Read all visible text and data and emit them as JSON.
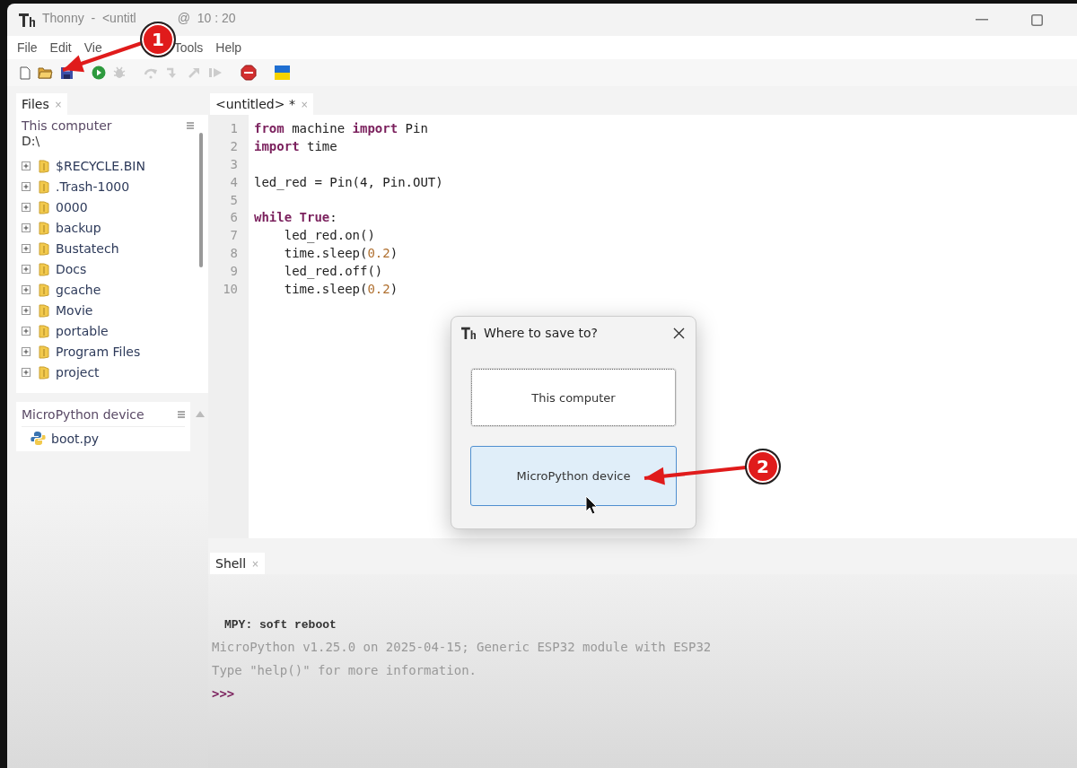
{
  "window": {
    "title": "Thonny  -  <untitl",
    "title_tail": "@  10 : 20"
  },
  "menu": [
    "File",
    "Edit",
    "Vie",
    "Tools",
    "Help"
  ],
  "files_panel": {
    "tab": {
      "label": "Files",
      "close": "×"
    },
    "location": "This computer",
    "path": "D:\\",
    "items": [
      {
        "name": "$RECYCLE.BIN",
        "expanded": false
      },
      {
        "name": ".Trash-1000",
        "expanded": false
      },
      {
        "name": "0000",
        "expanded": false
      },
      {
        "name": "backup",
        "expanded": false
      },
      {
        "name": "Bustatech",
        "expanded": false
      },
      {
        "name": "Docs",
        "expanded": false
      },
      {
        "name": "gcache",
        "expanded": false
      },
      {
        "name": "Movie",
        "expanded": false
      },
      {
        "name": "portable",
        "expanded": false
      },
      {
        "name": "Program Files",
        "expanded": false
      },
      {
        "name": "project",
        "expanded": false
      }
    ],
    "device": {
      "title": "MicroPython device",
      "files": [
        "boot.py"
      ]
    }
  },
  "editor": {
    "tab": {
      "label": "<untitled> *",
      "close": "×"
    },
    "lines": [
      {
        "number": "1",
        "tokens": [
          {
            "kind": "keyword",
            "text": "from"
          },
          {
            "kind": "plain",
            "text": " machine "
          },
          {
            "kind": "keyword",
            "text": "import"
          },
          {
            "kind": "plain",
            "text": " Pin"
          }
        ]
      },
      {
        "number": "2",
        "tokens": [
          {
            "kind": "keyword",
            "text": "import"
          },
          {
            "kind": "plain",
            "text": " time"
          }
        ]
      },
      {
        "number": "3"
      },
      {
        "number": "4",
        "tokens": [
          {
            "kind": "plain",
            "text": "led_red = Pin(4, Pin.OUT)"
          }
        ]
      },
      {
        "number": "5"
      },
      {
        "number": "6",
        "tokens": [
          {
            "kind": "keyword",
            "text": "while"
          },
          {
            "kind": "keyword",
            "text": " True"
          },
          {
            "kind": "plain",
            "text": ":"
          }
        ]
      },
      {
        "number": "7",
        "tokens": [
          {
            "kind": "plain",
            "text": "    led_red.on()"
          }
        ]
      },
      {
        "number": "8",
        "tokens": [
          {
            "kind": "plain",
            "text": "    time.sleep("
          },
          {
            "kind": "number",
            "text": "0.2"
          },
          {
            "kind": "plain",
            "text": ")"
          }
        ]
      },
      {
        "number": "9",
        "tokens": [
          {
            "kind": "plain",
            "text": "    led_red.off()"
          }
        ]
      },
      {
        "number": "10",
        "tokens": [
          {
            "kind": "plain",
            "text": "    time.sleep("
          },
          {
            "kind": "number",
            "text": "0.2"
          },
          {
            "kind": "plain",
            "text": ")"
          }
        ]
      }
    ]
  },
  "shell": {
    "tab": {
      "label": "Shell",
      "close": "×"
    },
    "lines": [
      {
        "kind": "system",
        "text": "MPY: soft reboot"
      },
      {
        "kind": "output",
        "text": "MicroPython v1.25.0 on 2025-04-15; Generic ESP32 module with ESP32"
      },
      {
        "kind": "output",
        "text": "Type \"help()\" for more information."
      },
      {
        "kind": "prompt",
        "text": ">>>"
      }
    ]
  },
  "dialog": {
    "title": "Where to save to?",
    "buttons": [
      {
        "label": "This computer",
        "focused": true,
        "highlighted": false
      },
      {
        "label": "MicroPython device",
        "focused": false,
        "highlighted": true
      }
    ]
  },
  "callouts": [
    {
      "label": "1"
    },
    {
      "label": "2"
    }
  ]
}
